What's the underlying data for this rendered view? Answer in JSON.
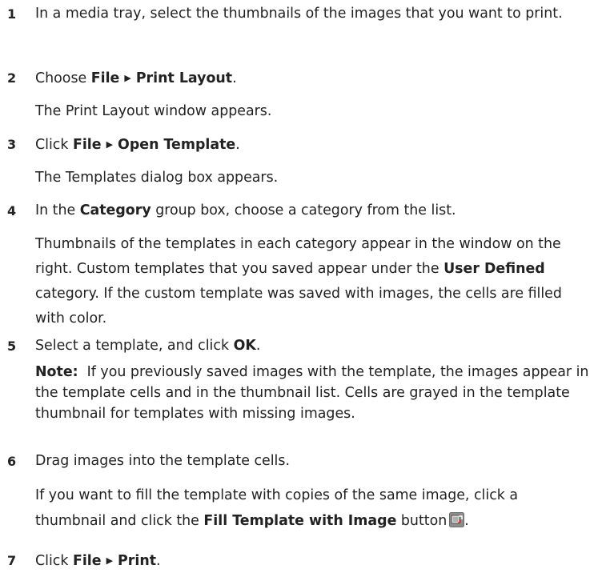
{
  "steps": [
    {
      "number": "1",
      "text": "In a media tray, select the thumbnails of the images that you want to print."
    },
    {
      "number": "2",
      "pre": "Choose ",
      "menu": "File",
      "item": "Print Layout",
      "post": ".",
      "result": "The Print Layout window appears."
    },
    {
      "number": "3",
      "pre": "Click ",
      "menu": "File",
      "item": "Open Template",
      "post": ".",
      "result": "The Templates dialog box appears."
    },
    {
      "number": "4",
      "pre": "In the ",
      "bold": "Category",
      "post": " group box, choose a category from the list.",
      "detail_pre": "Thumbnails of the templates in each category appear in the window on the right. Custom templates that you saved appear under the ",
      "detail_bold": "User Defined",
      "detail_post": " category. If the custom template was saved with images, the cells are filled with color."
    },
    {
      "number": "5",
      "pre": "Select a template, and click ",
      "bold": "OK",
      "post": ".",
      "note_label": "Note:",
      "note_text": "If you previously saved images with the template, the images appear in the template cells and in the thumbnail list. Cells are grayed in the template thumbnail for templates with missing images."
    },
    {
      "number": "6",
      "text": "Drag images into the template cells.",
      "detail_pre": "If you want to fill the template with copies of the same image, click a thumbnail and click the ",
      "detail_bold": "Fill Template with Image",
      "detail_post": " button",
      "detail_end": "."
    },
    {
      "number": "7",
      "pre": "Click ",
      "menu": "File",
      "item": "Print",
      "post": "."
    }
  ],
  "icons": {
    "arrow": "menu-arrow-icon",
    "fill_button": "fill-template-button-icon"
  }
}
